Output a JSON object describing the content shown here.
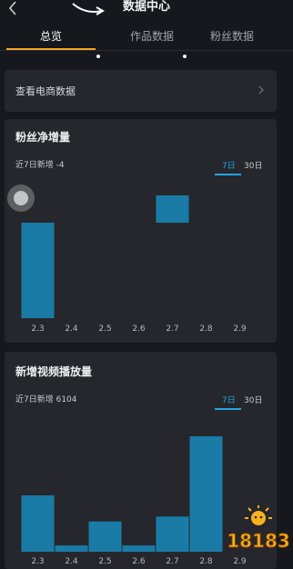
{
  "header": {
    "title": "数据中心"
  },
  "tabs": [
    {
      "label": "总览"
    },
    {
      "label": "作品数据"
    },
    {
      "label": "粉丝数据"
    }
  ],
  "ecommerce_link": {
    "label": "查看电商数据"
  },
  "fans_card": {
    "title": "粉丝净增量",
    "subtitle": "近7日新增 -4",
    "toggle_7": "7日",
    "toggle_30": "30日",
    "chart_data": {
      "type": "bar",
      "categories": [
        "2.3",
        "2.4",
        "2.5",
        "2.6",
        "2.7",
        "2.8",
        "2.9"
      ],
      "values": [
        -7,
        0,
        0,
        0,
        2,
        0,
        0
      ],
      "ylim": [
        -7,
        2
      ],
      "color": "#1a7ba6",
      "xlabel": "",
      "ylabel": ""
    }
  },
  "views_card": {
    "title": "新增视频播放量",
    "subtitle": "近7日新增 6104",
    "toggle_7": "7日",
    "toggle_30": "30日",
    "chart_data": {
      "type": "bar",
      "categories": [
        "2.3",
        "2.4",
        "2.5",
        "2.6",
        "2.7",
        "2.8",
        "2.9"
      ],
      "values": [
        1250,
        140,
        670,
        140,
        780,
        2560,
        0
      ],
      "ylim": [
        0,
        2560
      ],
      "color": "#1a7ba6",
      "xlabel": "",
      "ylabel": ""
    }
  },
  "watermark": {
    "text": "18183"
  },
  "colors": {
    "accent": "#f5a623",
    "bar": "#1a7ba6",
    "toggle": "#22a6e0",
    "card": "#25272d",
    "background": "#16181d"
  }
}
